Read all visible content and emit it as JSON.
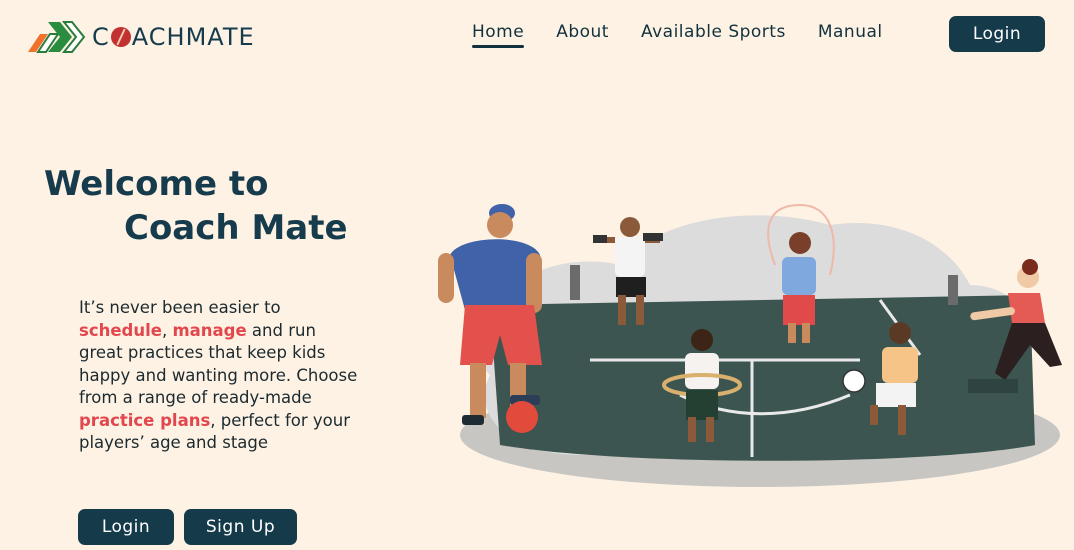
{
  "brand": {
    "name_before": "C",
    "name_after": "ACHMATE"
  },
  "nav": {
    "items": [
      {
        "label": "Home",
        "active": true
      },
      {
        "label": "About",
        "active": false
      },
      {
        "label": "Available Sports",
        "active": false
      },
      {
        "label": "Manual",
        "active": false
      }
    ],
    "login_label": "Login"
  },
  "hero": {
    "title_line1": "Welcome to",
    "title_line2": "Coach Mate",
    "desc_part1": "It’s never been easier to ",
    "desc_hl1": "schedule",
    "desc_part2": ", ",
    "desc_hl2": "manage",
    "desc_part3": " and run great practices that keep kids happy and wanting more. Choose from a range of ready-made ",
    "desc_hl3": "practice plans",
    "desc_part4": ", perfect for your players’ age and stage",
    "login_label": "Login",
    "signup_label": "Sign Up"
  },
  "colors": {
    "background": "#fdf2e3",
    "primary": "#153a4a",
    "highlight": "#e2474d"
  },
  "icons": {
    "logo": "chevron-arrows-logo",
    "ball": "cricket-ball-icon"
  }
}
